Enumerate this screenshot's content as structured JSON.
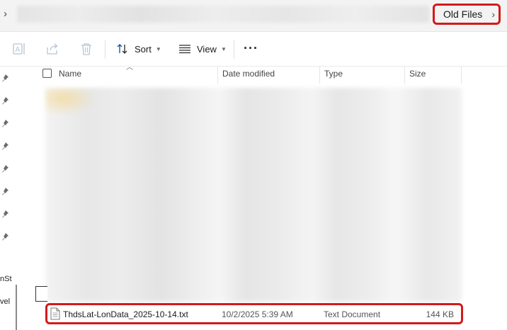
{
  "address_bar": {
    "current_crumb": "Old Files"
  },
  "toolbar": {
    "sort_label": "Sort",
    "view_label": "View"
  },
  "nav": {
    "pinned_count": 8,
    "partial_labels": [
      "nSt",
      "vel"
    ]
  },
  "columns": {
    "name": "Name",
    "date_modified": "Date modified",
    "type": "Type",
    "size": "Size"
  },
  "files": [
    {
      "name": "ThdsLat-LonData_2025-10-14.txt",
      "date_modified": "10/2/2025 5:39 AM",
      "type": "Text Document",
      "size": "144 KB",
      "icon": "text-file-icon"
    }
  ],
  "colors": {
    "highlight": "#d31a1a",
    "address_bg": "#f3f3f3"
  }
}
